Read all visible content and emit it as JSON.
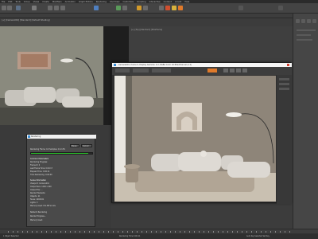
{
  "menubar": {
    "items": [
      "File",
      "Edit",
      "Tools",
      "Group",
      "Views",
      "Create",
      "Modifiers",
      "Animation",
      "Graph Editors",
      "Rendering",
      "Civil View",
      "Customize",
      "Scripting",
      "Interactive",
      "Content",
      "Arnold",
      "Help"
    ]
  },
  "viewport_left": {
    "label": "[+] [Camera001] [Standard] [Default Shading]"
  },
  "viewport_right": {
    "label": "[+] [Top] [Standard] [Wireframe]"
  },
  "render_frame": {
    "title": "Camera001, frame 0, Display Gamma: 2.2, RGBA Color 16 Bits/Channel (1:1)",
    "area_label": "Area to Render:",
    "viewport_label": "Viewport:",
    "preset_label": "Render Preset:"
  },
  "render_dialog": {
    "title": "Rendering",
    "pause_label": "Pause",
    "cancel_label": "Cancel",
    "status": "Rendering Frame: 0.0 Samples: 9.4.13%",
    "progress_percent": 93,
    "section_params": "Common Parameters",
    "rows_left": [
      "Rendering Progress:",
      "Frame #: 0",
      "Last Frame Time: 0:00:17",
      "Elapsed Time: 0:00:11",
      "Time Remaining: 0:00:00"
    ],
    "section_scene": "Scene Information",
    "rows_scene": [
      "Viewport: Camera001",
      "Output Size: 1200 x 900",
      "Output File: ...",
      "Render Elements",
      "Objects: 21",
      "Faces: 2480321",
      "Lights: 3",
      "Memory Used: P:6.3M V:2.1G"
    ],
    "rows_bottom": [
      "Network Rendering",
      "Render Progress...",
      "Memory Used:"
    ]
  },
  "statusbar": {
    "left": "1 Object Selected",
    "middle": "Rendering Time 0:00:11",
    "right": "Auto Key  Selected  Set Key"
  },
  "colors": {
    "accent_green": "#2bc42b",
    "title_bar": "#f5f5f5"
  }
}
